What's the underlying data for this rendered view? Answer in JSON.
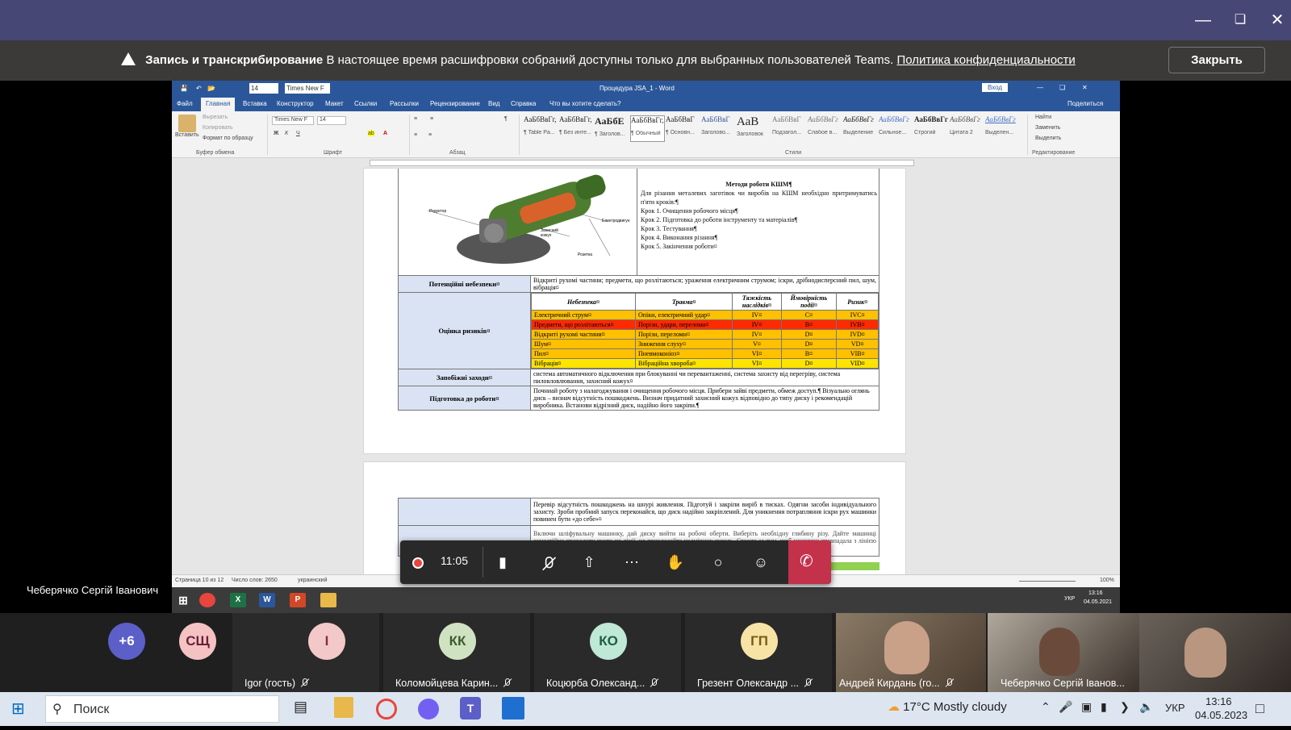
{
  "banner": {
    "title": "Запись и транскрибирование",
    "message": "В настоящее время расшифровки собраний доступны только для выбранных пользователей Teams.",
    "link": "Политика конфиденциальности",
    "close_label": "Закрыть"
  },
  "word": {
    "title": "Процедура JSA_1  -  Word",
    "login": "Вход",
    "share": "Поделиться",
    "font_size": "14",
    "font_name": "Times New F",
    "tabs": [
      "Файл",
      "Главная",
      "Вставка",
      "Конструктор",
      "Макет",
      "Ссылки",
      "Рассылки",
      "Рецензирование",
      "Вид",
      "Справка"
    ],
    "tell_me": "Что вы хотите сделать?",
    "clipboard": {
      "paste": "Вставить",
      "cut": "Вырезать",
      "copy": "Копировать",
      "format": "Формат по образцу",
      "group": "Буфер обмена"
    },
    "font_group": "Шрифт",
    "paragraph_group": "Абзац",
    "styles_group": "Стили",
    "editing_group": "Редактирование",
    "editing": {
      "find": "Найти",
      "replace": "Заменить",
      "select": "Выделить"
    },
    "styles": [
      {
        "preview": "АаБбВвГг,",
        "name": "¶ Table Pa..."
      },
      {
        "preview": "АаБбВвГг,",
        "name": "¶ Без инте..."
      },
      {
        "preview": "АаБбЕ",
        "name": "¶ Заголов..."
      },
      {
        "preview": "АаБбВвГг,",
        "name": "¶ Обычный"
      },
      {
        "preview": "АаБбВвГ",
        "name": "¶ Основн..."
      },
      {
        "preview": "АаБбВвГ",
        "name": "Заголово..."
      },
      {
        "preview": "АаВ",
        "name": "Заголовок"
      },
      {
        "preview": "АаБбВвГ",
        "name": "Подзагол..."
      },
      {
        "preview": "АаБбВвГг",
        "name": "Слабое в..."
      },
      {
        "preview": "АаБбВвГг",
        "name": "Выделение"
      },
      {
        "preview": "АаБбВвГг",
        "name": "Сильное..."
      },
      {
        "preview": "АаБбВвГг",
        "name": "Строгий"
      },
      {
        "preview": "АаБбВвГг",
        "name": "Цитата 2"
      },
      {
        "preview": "АаБбВвГг",
        "name": "Выделен..."
      }
    ],
    "status": {
      "page": "Страница 10 из 12",
      "words": "Число слов: 2650",
      "lang": "украинский",
      "zoom": "100%"
    },
    "taskbar": {
      "lang": "УКР",
      "time": "13:16",
      "date": "04.05.2021"
    }
  },
  "document": {
    "diagram_labels": [
      "Редуктор",
      "Електродвигун",
      "Захисний кожух",
      "Розетка"
    ],
    "methods_title": "Методи роботи КШМ¶",
    "methods_intro": "Для різання металевих заготівок чи виробів на КШМ необхідно притримуватись п'яти кроків:¶",
    "steps": [
      "Крок 1. Очищення робочого місця¶",
      "Крок 2. Підготовка до роботи інструменту та матеріалів¶",
      "Крок 3. Тестування¶",
      "Крок 4. Виконання різання¶",
      "Крок 5. Закінчення роботи¤"
    ],
    "hazards_label": "Потенційні небезпеки¤",
    "hazards_text": "Відкриті рухомі частини; предмети, що розлітаються; ураження електричним струмом; іскри, дрібнодисперсний пил, шум, вібрація¤",
    "risk_label": "Оцінка ризиків¤",
    "risk_headers": [
      "Небезпека¤",
      "Травма¤",
      "Тяжкість наслідків¤",
      "Ймовірність події¤",
      "Ризик¤"
    ],
    "risk_rows": [
      {
        "hazard": "Електричний струм¤",
        "injury": "Опіки, електричний удар¤",
        "severity": "IV¤",
        "probability": "C¤",
        "risk": "IVC¤",
        "color": "#ffc000"
      },
      {
        "hazard": "Предмети, що розлітаються¤",
        "injury": "Порізи, удари, переломи¤",
        "severity": "IV¤",
        "probability": "B¤",
        "risk": "IVB¤",
        "color": "#ff2a00"
      },
      {
        "hazard": "Відкриті рухомі частини¤",
        "injury": "Порізи, переломи¤",
        "severity": "IV¤",
        "probability": "D¤",
        "risk": "IVD¤",
        "color": "#ffc000"
      },
      {
        "hazard": "Шум¤",
        "injury": "Зниження слуху¤",
        "severity": "V¤",
        "probability": "D¤",
        "risk": "VD¤",
        "color": "#ffc000"
      },
      {
        "hazard": "Пил¤",
        "injury": "Пневмоконіоз¤",
        "severity": "VI¤",
        "probability": "B¤",
        "risk": "VIB¤",
        "color": "#ffc000"
      },
      {
        "hazard": "Вібрація¤",
        "injury": "Вібраційна хвороба¤",
        "severity": "VI¤",
        "probability": "D¤",
        "risk": "VID¤",
        "color": "#ffe400"
      }
    ],
    "measures_label": "Запобіжні заходи¤",
    "measures_text": "система автоматичного відключення при блокуванні чи перевантаженні, система захисту від перегріву, система пиловловлювання, захисний кожух¤",
    "prep_label": "Підготовка до роботи¤",
    "prep_text": "Почниай роботу з налагоджування і очищення робочого місця. Прибери зайві предмети, обмеж доступ.¶ Візуально оглянь диск – визнач відсутність пошкоджень. Визнач придатний захисний кожух відповідно до типу диску і рекомендацій виробника. Встанови відрізний диск, надійно його закріпи.¶",
    "page2_text": "Перевір відсутність пошкоджень на шнурі живлення. Підготуй і закріпи виріб в тисках. Одягни засоби індивідуального захисту. Зроби пробний запуск переконайся, що диск надійно закріплений. Для уникнення потрапляння іскри рух машинки повинен бути «до себе»¤",
    "page2_text_b": "Включи шліфувальну машинку, дай диску вийти на робочі оберти. Виберіть необхідну глибину різу. Дайте машинці самостійно проходити чисто по лінії, не прикладайте надмірних зусиль. Стежте за тим, щоб машинки спавпадала з лінією розрізу. Вимкни машинку, дай диску повністю зупинитися, переконайся, що диск проходила мимо"
  },
  "call": {
    "timer": "11:05"
  },
  "presenter_name": "Чеберячко Сергій Іванович",
  "participants": [
    {
      "initials": "+6",
      "name": "",
      "color": "#5b5fc7",
      "text": "#fff"
    },
    {
      "initials": "СЩ",
      "name": "",
      "color": "#f4c2c2",
      "text": "#6b1f3a"
    },
    {
      "initials": "I",
      "name": "Igor (гость)",
      "color": "#f3c8c8",
      "text": "#8a2b3a"
    },
    {
      "initials": "КК",
      "name": "Коломойцева Карин...",
      "color": "#cfe3c2",
      "text": "#3e5a2a"
    },
    {
      "initials": "КО",
      "name": "Коцюрба Олександ...",
      "color": "#bfe8d6",
      "text": "#1e5c42"
    },
    {
      "initials": "ГП",
      "name": "Грезент Олександр ...",
      "color": "#f8e3a6",
      "text": "#7a5a10"
    },
    {
      "initials": "",
      "name": "Андрей Кирдань (го...",
      "color": "#6b5a4a",
      "text": "#fff"
    },
    {
      "initials": "",
      "name": "Чеберячко Сергій Іванов...",
      "color": "#4a4038",
      "text": "#fff"
    },
    {
      "initials": "",
      "name": "",
      "color": "#5a5048",
      "text": "#fff"
    }
  ],
  "taskbar": {
    "search": "Поиск",
    "weather": "17°C  Mostly cloudy",
    "lang": "УКР",
    "time": "13:16",
    "date": "04.05.2023"
  }
}
